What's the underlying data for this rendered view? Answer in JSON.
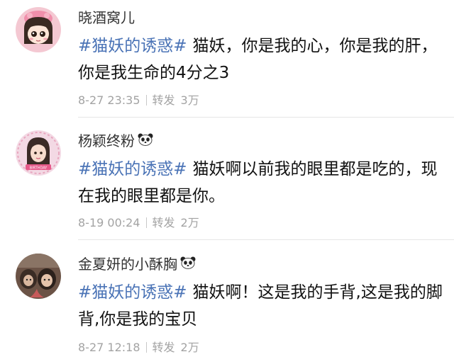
{
  "comments": [
    {
      "username": "晓酒窝儿",
      "hashtag": "#猫妖的诱惑#",
      "text": "猫妖，你是我的心，你是我的肝，你是我生命的4分之3",
      "time": "8-27 23:35",
      "repost_label": "转发",
      "repost_count": "3万",
      "badge": null
    },
    {
      "username": "杨颖终粉",
      "hashtag": "#猫妖的诱惑#",
      "text": "猫妖啊以前我的眼里都是吃的，现在我的眼里都是你。",
      "time": "8-19 00:24",
      "repost_label": "转发",
      "repost_count": "2万",
      "badge": "panda-icon"
    },
    {
      "username": "金夏妍的小酥胸",
      "hashtag": "#猫妖的诱惑#",
      "text": "猫妖啊！这是我的手背,这是我的脚背,你是我的宝贝",
      "time": "8-27 12:18",
      "repost_label": "转发",
      "repost_count": "2万",
      "badge": "panda-icon"
    }
  ],
  "colors": {
    "hashtag": "#4a73b6",
    "meta": "#a3a3a3",
    "divider": "#e6e6e6",
    "avatar1_bg": "#f4c8d2",
    "avatar2_bg": "#f3d9e4",
    "avatar3_bg": "#6b5346"
  }
}
